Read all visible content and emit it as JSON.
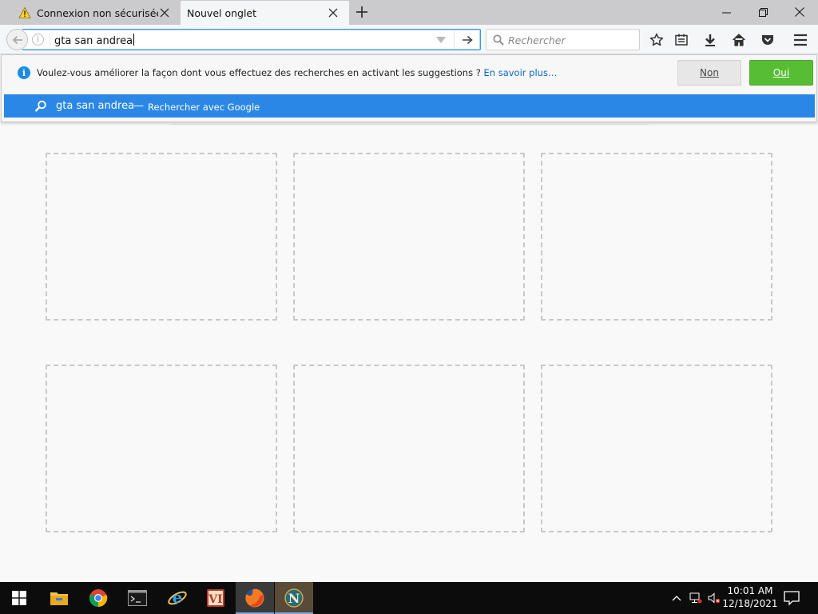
{
  "tabs": [
    {
      "label": "Connexion non sécurisée",
      "icon": "warning-icon",
      "active": false
    },
    {
      "label": "Nouvel onglet",
      "active": true
    }
  ],
  "urlbar": {
    "value": "gta san andrea"
  },
  "searchbar": {
    "placeholder": "Rechercher"
  },
  "notice": {
    "text": "Voulez-vous améliorer la façon dont vous effectuez des recherches en activant les suggestions ?",
    "link": "En savoir plus…",
    "no_label": "Non",
    "yes_label": "Oui"
  },
  "suggestion": {
    "query": "gta san andrea",
    "dash": "—",
    "action": "Rechercher avec Google"
  },
  "taskbar": {
    "apps": [
      "file-explorer-icon",
      "chrome-icon",
      "terminal-icon",
      "ie-icon",
      "vim-icon",
      "firefox-icon",
      "app-n-icon"
    ],
    "time": "10:01 AM",
    "date": "12/18/2021"
  },
  "colors": {
    "accent": "#2b87e6",
    "yes_button": "#57bd35",
    "link": "#0a68c4"
  }
}
